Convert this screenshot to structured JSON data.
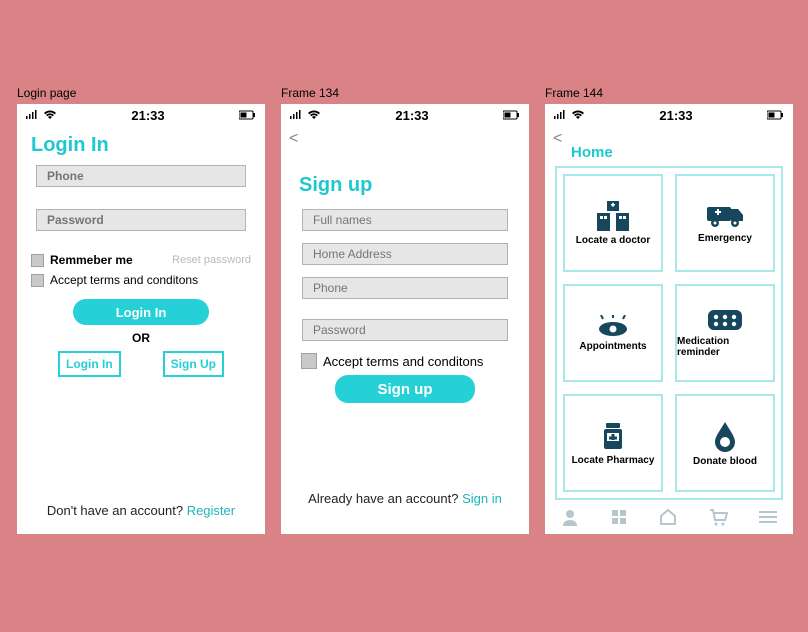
{
  "frame_labels": {
    "f1": "Login page",
    "f2": "Frame 134",
    "f3": "Frame 144"
  },
  "statusbar": {
    "time": "21:33"
  },
  "login": {
    "title": "Login In",
    "phone_placeholder": "Phone",
    "password_placeholder": "Password",
    "remember_label": "Remmeber  me",
    "reset_label": "Reset password",
    "terms_label": "Accept terms and conditons",
    "submit_label": "Login In",
    "or_label": "OR",
    "alt_login_label": "Login In",
    "alt_signup_label": "Sign Up",
    "foot_text": "Don't have an account? ",
    "foot_link": "Register"
  },
  "signup": {
    "title": "Sign up",
    "fullnames_placeholder": "Full names",
    "address_placeholder": "Home Address",
    "phone_placeholder": "Phone",
    "password_placeholder": "Password",
    "terms_label": "Accept terms and conditons",
    "submit_label": "Sign up",
    "foot_text": "Already have an account? ",
    "foot_link": "Sign in"
  },
  "home": {
    "title": "Home",
    "tiles": [
      {
        "label": "Locate a doctor"
      },
      {
        "label": "Emergency"
      },
      {
        "label": "Appointments"
      },
      {
        "label": "Medication reminder"
      },
      {
        "label": "Locate Pharmacy"
      },
      {
        "label": "Donate blood"
      }
    ]
  }
}
